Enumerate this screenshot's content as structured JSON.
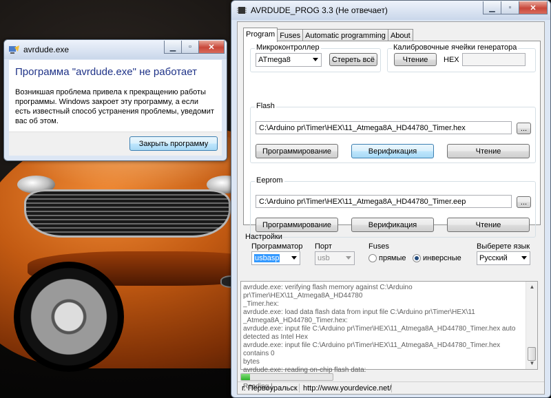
{
  "error_dialog": {
    "title": "avrdude.exe",
    "heading": "Программа \"avrdude.exe\" не работает",
    "message": "Возникшая проблема привела к прекращению работы программы. Windows закроет эту программу, а если есть известный способ устранения проблемы, уведомит вас об этом.",
    "close_button": "Закрыть программу",
    "heading_color": "#1e3287"
  },
  "main_window": {
    "title": "AVRDUDE_PROG 3.3 (Не отвечает)",
    "tabs": [
      {
        "label": "Program",
        "active": true
      },
      {
        "label": "Fuses",
        "active": false
      },
      {
        "label": "Automatic programming",
        "active": false
      },
      {
        "label": "About",
        "active": false
      }
    ],
    "mcu": {
      "label": "Микроконтроллер",
      "selected": "ATmega8",
      "erase_button": "Стереть всё"
    },
    "calibration": {
      "label": "Калибровочные ячейки генератора",
      "read_button": "Чтение",
      "hex_label": "HEX",
      "hex_value": ""
    },
    "flash": {
      "label": "Flash",
      "path": "C:\\Arduino pr\\Timer\\HEX\\11_Atmega8A_HD44780_Timer.hex",
      "browse": "...",
      "program_button": "Программирование",
      "verify_button": "Верификация",
      "read_button": "Чтение"
    },
    "eeprom": {
      "label": "Eeprom",
      "path": "C:\\Arduino pr\\Timer\\HEX\\11_Atmega8A_HD44780_Timer.eep",
      "browse": "...",
      "program_button": "Программирование",
      "verify_button": "Верификация",
      "read_button": "Чтение"
    },
    "settings": {
      "label": "Настройки",
      "programmer_label": "Программатор",
      "programmer_value": "usbasp",
      "port_label": "Порт",
      "port_value": "usb",
      "fuses_label": "Fuses",
      "fuses_option_direct": "прямые",
      "fuses_option_inverse": "инверсные",
      "fuses_selected": "инверсные",
      "language_label": "Выберете язык",
      "language_value": "Русский"
    },
    "log_lines": [
      "avrdude.exe: verifying flash memory against C:\\Arduino pr\\Timer\\HEX\\11_Atmega8A_HD44780",
      "_Timer.hex:",
      "avrdude.exe: load data flash data from input file C:\\Arduino pr\\Timer\\HEX\\11",
      "_Atmega8A_HD44780_Timer.hex:",
      "avrdude.exe: input file C:\\Arduino pr\\Timer\\HEX\\11_Atmega8A_HD44780_Timer.hex auto",
      "detected as Intel Hex",
      "avrdude.exe: input file C:\\Arduino pr\\Timer\\HEX\\11_Atmega8A_HD44780_Timer.hex contains 0",
      "bytes",
      "avrdude.exe: reading on-chip flash data:",
      "",
      "Reading |"
    ],
    "progress_fraction": 0.1,
    "progress_color": "#2fb32b",
    "status": {
      "city": "г. Первоуральск",
      "url": "http://www.yourdevice.net/"
    }
  }
}
